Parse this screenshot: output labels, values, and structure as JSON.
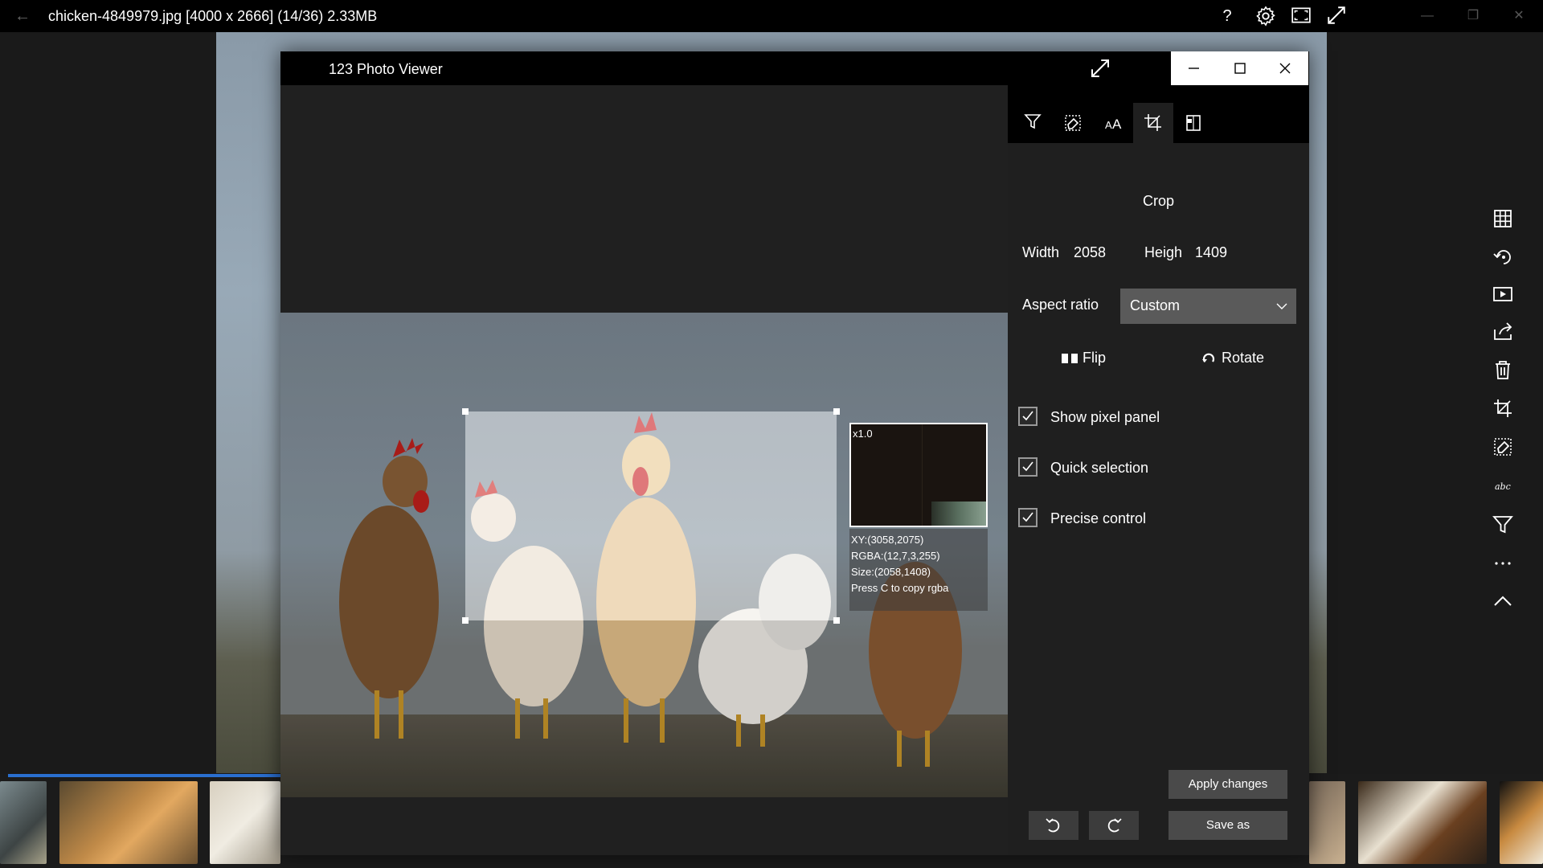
{
  "topbar": {
    "title": "chicken-4849979.jpg  [4000 x 2666]  (14/36) 2.33MB",
    "icons": [
      "back-arrow-icon",
      "help-icon",
      "gear-icon",
      "fullscreen-icon",
      "expand-icon"
    ]
  },
  "dialog": {
    "title": "123 Photo Viewer",
    "tabs": [
      "filter-icon",
      "eraser-icon",
      "text-icon",
      "crop-icon",
      "compare-icon"
    ],
    "active_tab": "crop-icon",
    "panel": {
      "heading": "Crop",
      "width_label": "Width",
      "width_value": "2058",
      "height_label": "Heigh",
      "height_value": "1409",
      "aspect_label": "Aspect ratio",
      "aspect_value": "Custom",
      "flip_label": "Flip",
      "rotate_label": "Rotate",
      "checkboxes": [
        {
          "label": "Show pixel panel",
          "checked": true
        },
        {
          "label": "Quick selection",
          "checked": true
        },
        {
          "label": "Precise control",
          "checked": true
        }
      ],
      "apply_label": "Apply changes",
      "save_label": "Save as"
    },
    "pixel_panel": {
      "zoom": "x1.0",
      "xy": "XY:(3058,2075)",
      "rgba": "RGBA:(12,7,3,255)",
      "size": "Size:(2058,1408)",
      "hint": "Press C to copy rgba"
    }
  },
  "sidebar": {
    "icons": [
      "grid-icon",
      "rotate-icon",
      "slideshow-icon",
      "share-icon",
      "delete-icon",
      "crop-icon",
      "eraser-icon",
      "text-abc-icon",
      "filter-icon",
      "more-icon",
      "chevron-up-icon"
    ]
  },
  "colors": {
    "accent": "#2a6fd0",
    "background": "#1a1a1a",
    "panel": "#1f1f1f",
    "select": "#5a5a5a"
  }
}
